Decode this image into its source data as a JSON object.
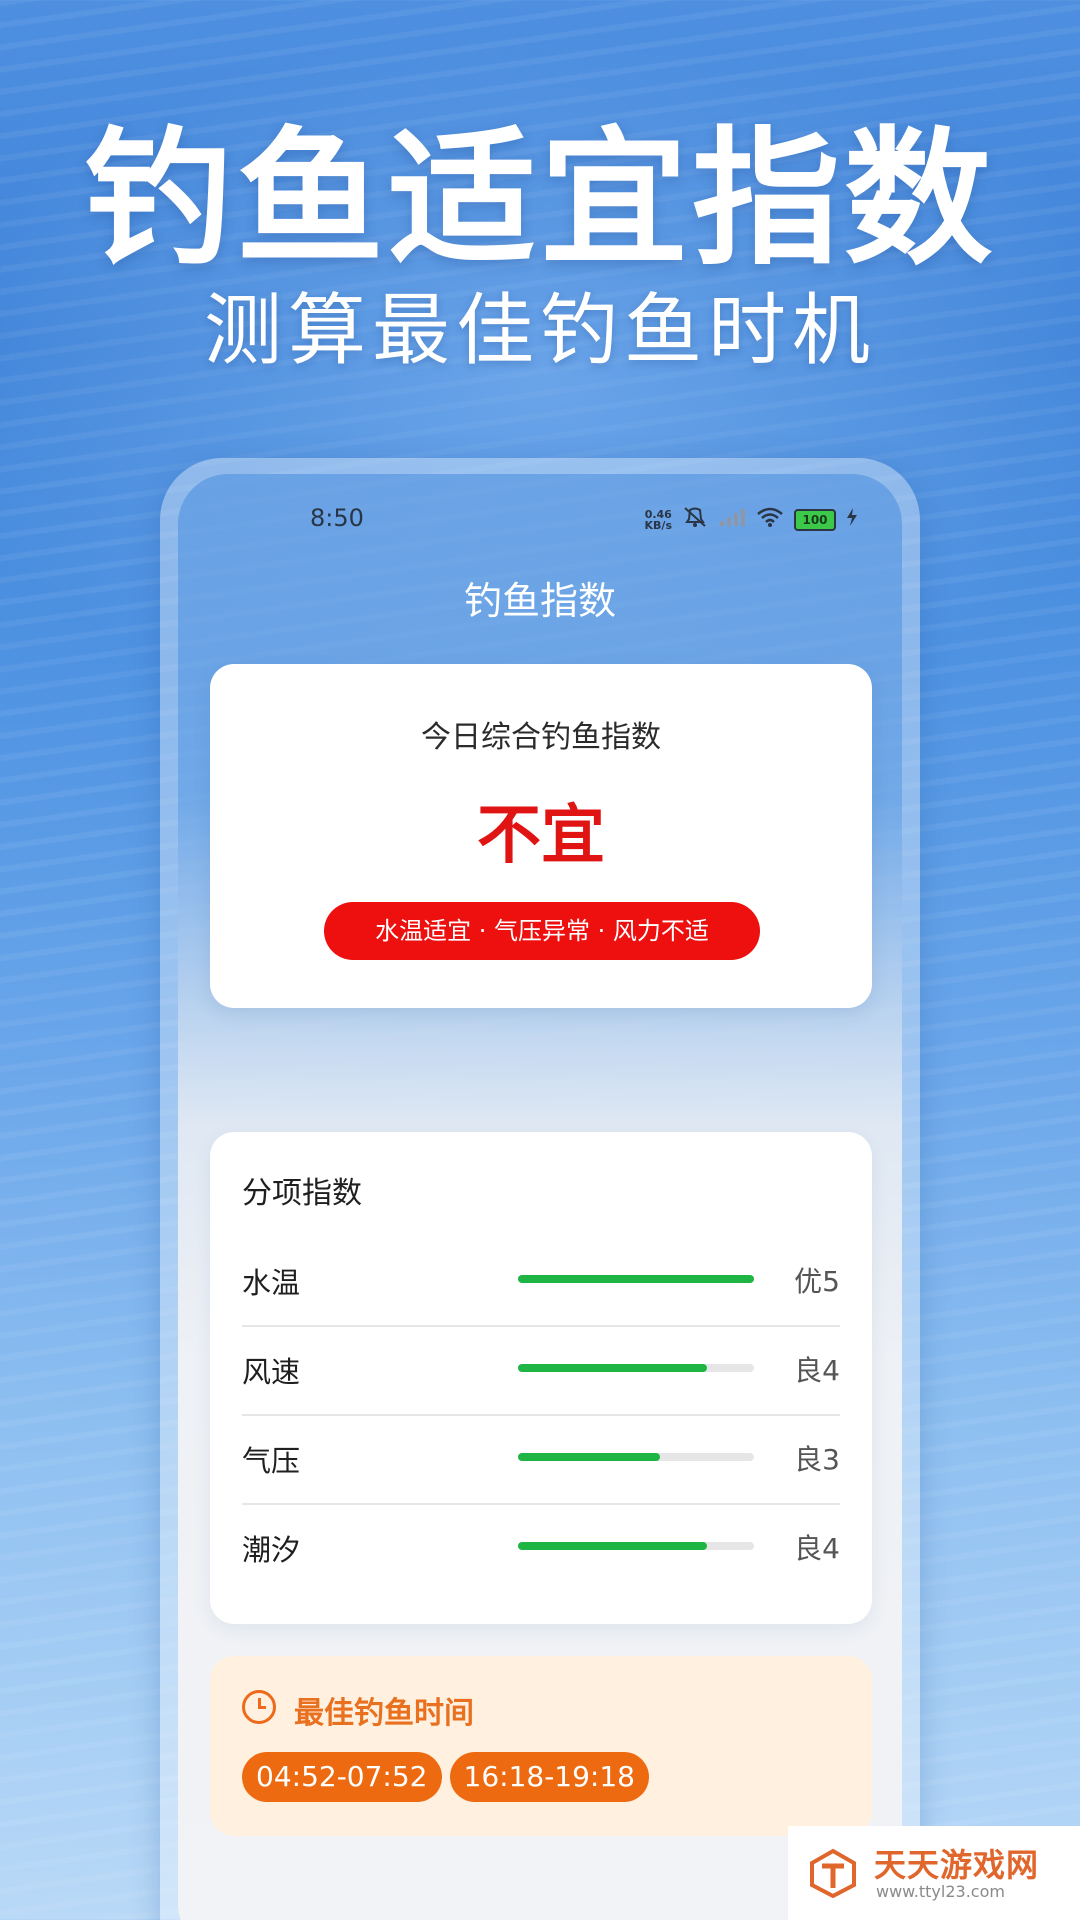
{
  "hero": {
    "title": "钓鱼适宜指数",
    "subtitle": "测算最佳钓鱼时机"
  },
  "status_bar": {
    "time": "8:50",
    "net_speed_value": "0.46",
    "net_speed_unit": "KB/s",
    "battery": "100",
    "icons": [
      "mute-icon",
      "signal-icon",
      "wifi-icon",
      "battery-icon",
      "charging-icon"
    ]
  },
  "app": {
    "title": "钓鱼指数"
  },
  "overall": {
    "label": "今日综合钓鱼指数",
    "value": "不宜",
    "summary": "水温适宜 · 气压异常 · 风力不适"
  },
  "sub_indices": {
    "heading": "分项指数",
    "items": [
      {
        "name": "水温",
        "grade": "优5",
        "level": 5,
        "max": 5
      },
      {
        "name": "风速",
        "grade": "良4",
        "level": 4,
        "max": 5
      },
      {
        "name": "气压",
        "grade": "良3",
        "level": 3,
        "max": 5
      },
      {
        "name": "潮汐",
        "grade": "良4",
        "level": 4,
        "max": 5
      }
    ]
  },
  "best_time": {
    "heading": "最佳钓鱼时间",
    "slots": [
      "04:52-07:52",
      "16:18-19:18"
    ]
  },
  "watermark": {
    "name": "天天游戏网",
    "url": "www.ttyl23.com"
  },
  "colors": {
    "danger": "#ee0f0f",
    "good": "#1fb544",
    "accent_orange": "#ee6a10"
  }
}
